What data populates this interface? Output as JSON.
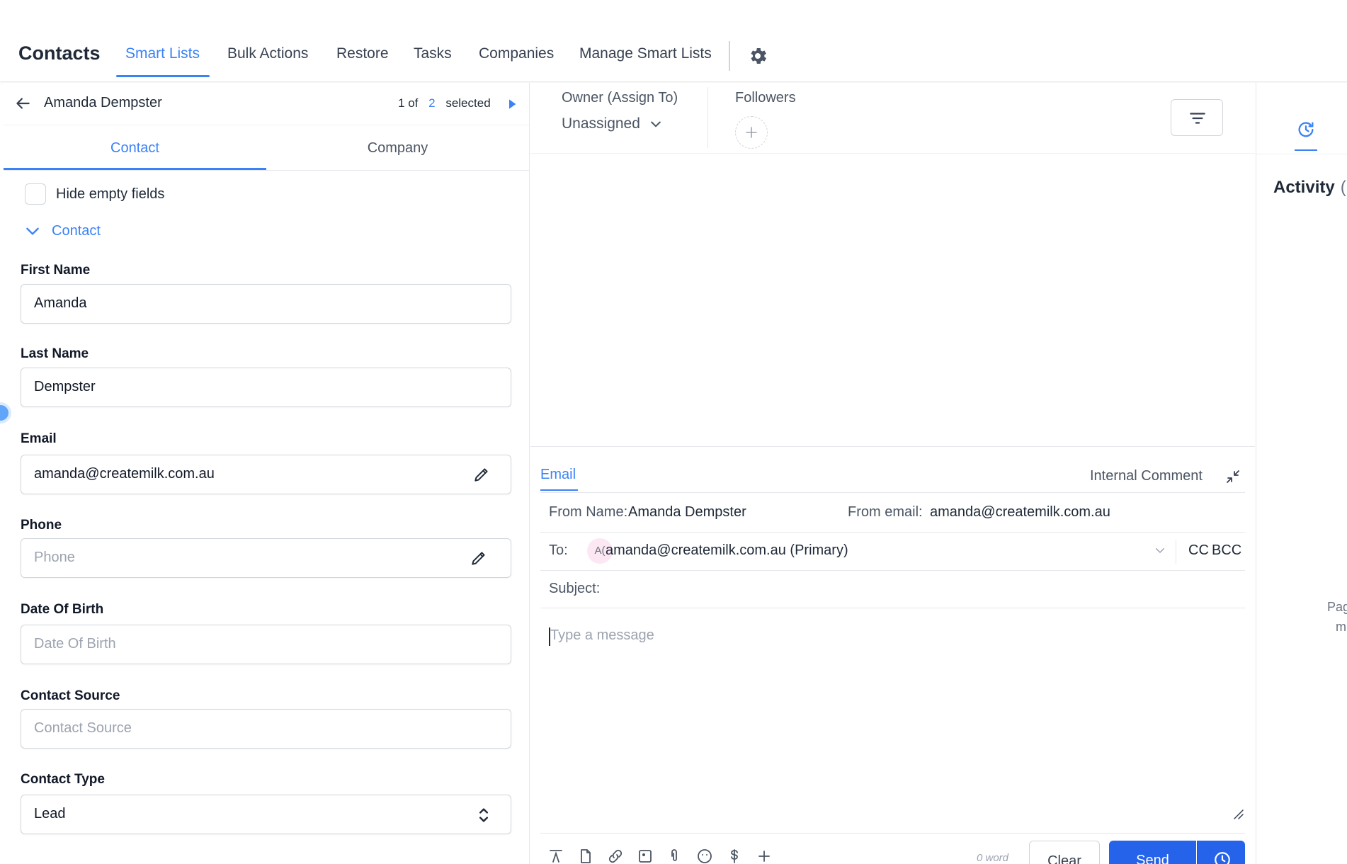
{
  "topnav": {
    "title": "Contacts",
    "tabs": [
      {
        "label": "Smart Lists",
        "active": true
      },
      {
        "label": "Bulk Actions"
      },
      {
        "label": "Restore"
      },
      {
        "label": "Tasks"
      },
      {
        "label": "Companies"
      },
      {
        "label": "Manage Smart Lists"
      }
    ],
    "settings_icon": "gear-icon"
  },
  "left": {
    "contact_name": "Amanda Dempster",
    "pager": {
      "current": "1",
      "of_label": "of",
      "total": "2",
      "selected_label": "selected"
    },
    "subtabs": [
      {
        "label": "Contact",
        "active": true
      },
      {
        "label": "Company"
      }
    ],
    "hide_empty_label": "Hide empty fields",
    "section_label": "Contact",
    "fields": {
      "first_name": {
        "label": "First Name",
        "value": "Amanda"
      },
      "last_name": {
        "label": "Last Name",
        "value": "Dempster"
      },
      "email": {
        "label": "Email",
        "value": "amanda@createmilk.com.au"
      },
      "phone": {
        "label": "Phone",
        "placeholder": "Phone"
      },
      "dob": {
        "label": "Date Of Birth",
        "placeholder": "Date Of Birth"
      },
      "source": {
        "label": "Contact Source",
        "placeholder": "Contact Source"
      },
      "type": {
        "label": "Contact Type",
        "value": "Lead"
      }
    }
  },
  "middle": {
    "owner_label": "Owner (Assign To)",
    "owner_value": "Unassigned",
    "followers_label": "Followers",
    "composer": {
      "tab_email": "Email",
      "tab_internal": "Internal Comment",
      "from_name_label": "From Name:",
      "from_name_value": "Amanda Dempster",
      "from_email_label": "From email:",
      "from_email_value": "amanda@createmilk.com.au",
      "to_label": "To:",
      "to_avatar": "A(",
      "to_value": "amanda@createmilk.com.au (Primary)",
      "cc_label": "CC",
      "bcc_label": "BCC",
      "subject_label": "Subject:",
      "message_placeholder": "Type a message",
      "word_count": "0 word",
      "clear_label": "Clear",
      "send_label": "Send"
    }
  },
  "right": {
    "activity_title": "Activity",
    "activity_count": "(",
    "note_line1": "Pag",
    "note_line2": "m"
  },
  "colors": {
    "accent": "#3b82f6",
    "send": "#2563eb"
  }
}
